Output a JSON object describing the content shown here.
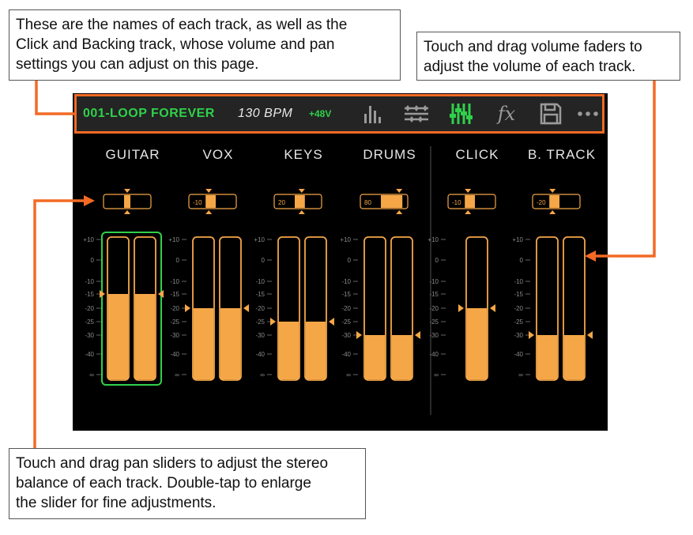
{
  "callouts": {
    "names": [
      "These are the names of each track, as well as the",
      "Click and Backing track, whose volume and pan",
      "settings you can adjust on this page."
    ],
    "faders": [
      "Touch and drag volume faders to",
      "adjust the volume of each track."
    ],
    "pan": [
      "Touch and drag pan sliders to adjust the stereo",
      "balance of each track. Double-tap to enlarge",
      "the slider for fine adjustments."
    ]
  },
  "topbar": {
    "song": "001-LOOP FOREVER",
    "bpm": "130 BPM",
    "phantom": "+48V",
    "icons": [
      "bar-graph-icon",
      "routing-icon",
      "mixer-icon",
      "fx-icon",
      "save-icon",
      "more-icon"
    ],
    "fx_label": "fx",
    "active_icon": "mixer-icon"
  },
  "colors": {
    "accent_orange": "#f36a25",
    "fader_fill": "#f5a748",
    "active_green": "#2fd14a",
    "background": "#000000",
    "topbar": "#242424"
  },
  "scale_labels": [
    "+10",
    "0",
    "-10",
    "-15",
    "-20",
    "-25",
    "-30",
    "-40",
    "∞"
  ],
  "tracks": [
    {
      "name": "GUITAR",
      "pan_value": "",
      "pan": 0.0,
      "channels": 2,
      "level_db": -15,
      "selected": true
    },
    {
      "name": "VOX",
      "pan_value": "-10",
      "pan": -0.2,
      "channels": 2,
      "level_db": -20,
      "selected": false
    },
    {
      "name": "KEYS",
      "pan_value": "20",
      "pan": 0.2,
      "channels": 2,
      "level_db": -25,
      "selected": false
    },
    {
      "name": "DRUMS",
      "pan_value": "80",
      "pan": 0.8,
      "channels": 2,
      "level_db": -30,
      "selected": false
    },
    {
      "name": "CLICK",
      "pan_value": "-10",
      "pan": -0.2,
      "channels": 1,
      "level_db": -20,
      "selected": false
    },
    {
      "name": "B. TRACK",
      "pan_value": "-20",
      "pan": -0.2,
      "channels": 2,
      "level_db": -30,
      "selected": false
    }
  ]
}
